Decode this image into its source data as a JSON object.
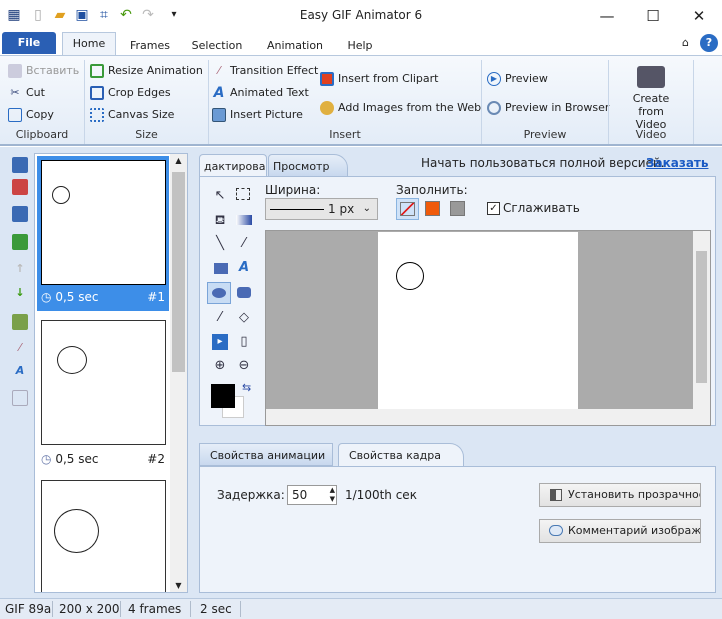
{
  "window": {
    "title": "Easy GIF Animator 6",
    "minimize": "—",
    "maximize": "☐",
    "close": "✕"
  },
  "ribbon_tabs": {
    "file": "File",
    "tabs": [
      "Home",
      "Frames",
      "Selection",
      "Animation",
      "Help"
    ],
    "help": "?"
  },
  "clipboard": {
    "paste": "Вставить",
    "cut": "Cut",
    "copy": "Copy",
    "label": "Clipboard"
  },
  "size": {
    "resize": "Resize Animation",
    "crop": "Crop Edges",
    "canvas": "Canvas Size",
    "label": "Size"
  },
  "insert": {
    "transition": "Transition Effect",
    "text": "Animated Text",
    "picture": "Insert Picture",
    "clipart": "Insert from Clipart",
    "web": "Add Images from the Web",
    "label": "Insert"
  },
  "preview": {
    "preview": "Preview",
    "browser": "Preview in Browser",
    "label": "Preview"
  },
  "video": {
    "create": "Create from Video",
    "label": "Video"
  },
  "frames": [
    {
      "delay": "0,5 sec",
      "num": "#1"
    },
    {
      "delay": "0,5 sec",
      "num": "#2"
    },
    {
      "delay": "",
      "num": ""
    }
  ],
  "editor": {
    "tab_edit": "дактирова",
    "tab_preview": "Просмотр",
    "promo": "Начать пользоваться полной версией.",
    "order_link": "Заказать",
    "width_label": "Ширина:",
    "width_value": "1 px",
    "fill_label": "Заполнить:",
    "smooth_label": "Сглаживать",
    "smooth_checked": true
  },
  "colors": {
    "accent": "#2a5fb4",
    "fill_orange": "#f05a0a",
    "fill_gray": "#999999",
    "selected_frame": "#3d8ee8"
  },
  "props": {
    "tab_anim": "Свойства анимации",
    "tab_frame": "Свойства кадра",
    "delay_label": "Задержка:",
    "delay_value": "50",
    "delay_unit": "1/100th сек",
    "transparency_btn": "Установить прозрачнос",
    "comment_btn": "Комментарий изображ"
  },
  "status": {
    "format": "GIF 89a",
    "size": "200 x 200",
    "frames": "4 frames",
    "duration": "2 sec"
  }
}
